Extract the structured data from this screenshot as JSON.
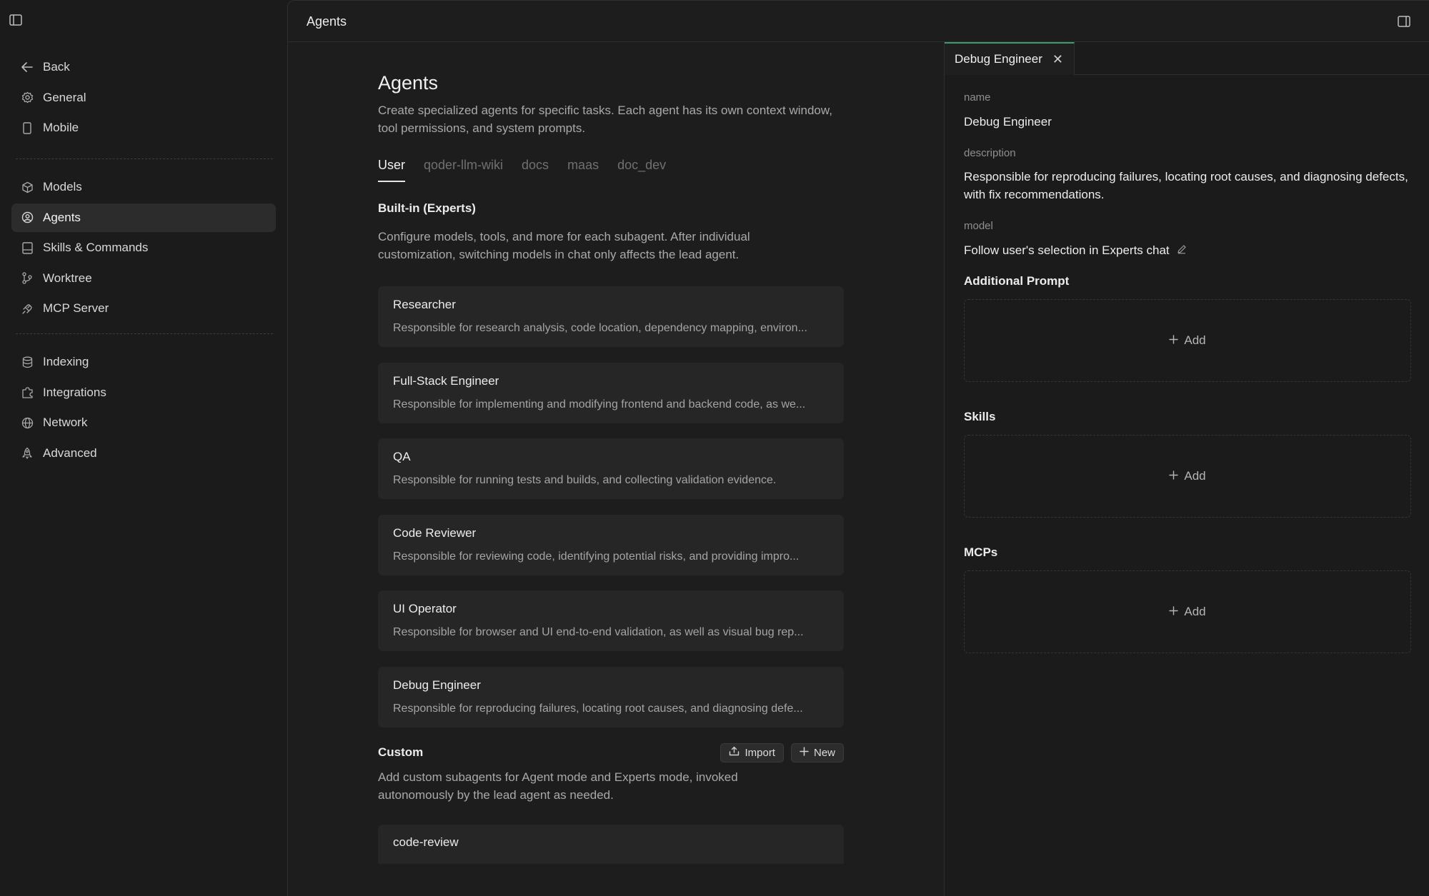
{
  "topbar": {
    "title": "Agents"
  },
  "sidebar": {
    "items": [
      {
        "label": "Back",
        "icon": "arrow-left-icon"
      },
      {
        "label": "General",
        "icon": "gear-icon"
      },
      {
        "label": "Mobile",
        "icon": "mobile-icon"
      },
      {
        "label": "Models",
        "icon": "cube-icon"
      },
      {
        "label": "Agents",
        "icon": "agent-icon",
        "active": true
      },
      {
        "label": "Skills & Commands",
        "icon": "book-icon"
      },
      {
        "label": "Worktree",
        "icon": "branch-icon"
      },
      {
        "label": "MCP Server",
        "icon": "plug-icon"
      },
      {
        "label": "Indexing",
        "icon": "database-icon"
      },
      {
        "label": "Integrations",
        "icon": "puzzle-icon"
      },
      {
        "label": "Network",
        "icon": "globe-icon"
      },
      {
        "label": "Advanced",
        "icon": "rocket-icon"
      }
    ]
  },
  "main": {
    "title": "Agents",
    "description": "Create specialized agents for specific tasks. Each agent has its own context window, tool permissions, and system prompts.",
    "tabs": [
      {
        "label": "User",
        "active": true
      },
      {
        "label": "qoder-llm-wiki"
      },
      {
        "label": "docs"
      },
      {
        "label": "maas"
      },
      {
        "label": "doc_dev"
      }
    ],
    "builtin": {
      "title": "Built-in (Experts)",
      "description": "Configure models, tools, and more for each subagent. After individual customization, switching models in chat only affects the lead agent.",
      "agents": [
        {
          "name": "Researcher",
          "description": "Responsible for research analysis, code location, dependency mapping, environ..."
        },
        {
          "name": "Full-Stack Engineer",
          "description": "Responsible for implementing and modifying frontend and backend code, as we..."
        },
        {
          "name": "QA",
          "description": "Responsible for running tests and builds, and collecting validation evidence."
        },
        {
          "name": "Code Reviewer",
          "description": "Responsible for reviewing code, identifying potential risks, and providing impro..."
        },
        {
          "name": "UI Operator",
          "description": "Responsible for browser and UI end-to-end validation, as well as visual bug rep..."
        },
        {
          "name": "Debug Engineer",
          "description": "Responsible for reproducing failures, locating root causes, and diagnosing defe..."
        }
      ]
    },
    "custom": {
      "title": "Custom",
      "import_label": "Import",
      "new_label": "New",
      "description": "Add custom subagents for Agent mode and Experts mode, invoked autonomously by the lead agent as needed.",
      "agents": [
        {
          "name": "code-review"
        }
      ]
    }
  },
  "detail": {
    "tab_label": "Debug Engineer",
    "name_label": "name",
    "name_value": "Debug Engineer",
    "description_label": "description",
    "description_value": "Responsible for reproducing failures, locating root causes, and diagnosing defects, with fix recommendations.",
    "model_label": "model",
    "model_value": "Follow user's selection in Experts chat",
    "additional_prompt": {
      "title": "Additional Prompt",
      "add_label": "Add"
    },
    "skills": {
      "title": "Skills",
      "add_label": "Add"
    },
    "mcps": {
      "title": "MCPs",
      "add_label": "Add"
    }
  },
  "colors": {
    "background": "#1b1b1b",
    "card": "#262626",
    "accent_tab": "#3d9a6a",
    "text_primary": "#ececec",
    "text_secondary": "#a9a9a9"
  }
}
